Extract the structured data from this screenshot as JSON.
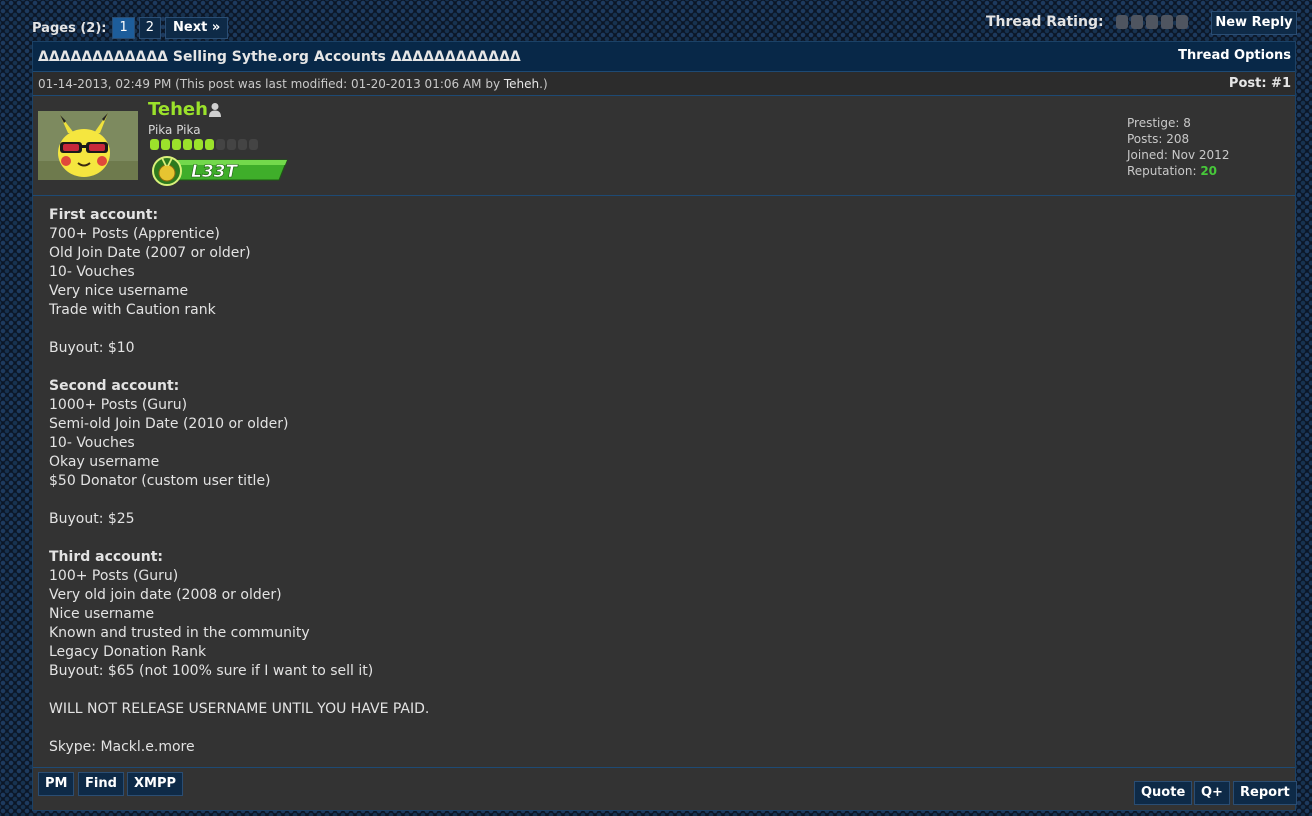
{
  "pagination": {
    "label": "Pages (2):",
    "pages": [
      "1",
      "2"
    ],
    "current": "1",
    "next_label": "Next »"
  },
  "rating": {
    "label": "Thread Rating:",
    "star_count": 5
  },
  "new_reply_label": "New Reply",
  "thread": {
    "title": "ΔΔΔΔΔΔΔΔΔΔΔΔ Selling Sythe.org Accounts ΔΔΔΔΔΔΔΔΔΔΔΔ",
    "options_label": "Thread Options"
  },
  "post": {
    "date_text": "01-14-2013, 02:49 PM (This post was last modified: 01-20-2013 01:06 AM by ",
    "modified_by": "Teheh",
    "date_suffix": ".)",
    "post_number_label": "Post: #1",
    "user": {
      "name": "Teheh",
      "title": "Pika Pika",
      "rank_label": "L33T",
      "pips_on": 6,
      "pips_total": 10,
      "stats": {
        "prestige": "Prestige: 8",
        "posts": "Posts: 208",
        "joined": "Joined: Nov 2012",
        "reputation_label": "Reputation: ",
        "reputation_value": "20"
      }
    },
    "body_lines": [
      {
        "text": "First account:",
        "bold": true
      },
      {
        "text": "700+ Posts (Apprentice)"
      },
      {
        "text": "Old Join Date (2007 or older)"
      },
      {
        "text": "10- Vouches"
      },
      {
        "text": "Very nice username"
      },
      {
        "text": "Trade with Caution rank"
      },
      {
        "text": ""
      },
      {
        "text": "Buyout: $10"
      },
      {
        "text": ""
      },
      {
        "text": "Second account:",
        "bold": true
      },
      {
        "text": "1000+ Posts (Guru)"
      },
      {
        "text": "Semi-old Join Date (2010 or older)"
      },
      {
        "text": "10- Vouches"
      },
      {
        "text": "Okay username"
      },
      {
        "text": "$50 Donator (custom user title)"
      },
      {
        "text": ""
      },
      {
        "text": "Buyout: $25"
      },
      {
        "text": ""
      },
      {
        "text": "Third account:",
        "bold": true
      },
      {
        "text": "100+ Posts (Guru)"
      },
      {
        "text": "Very old join date (2008 or older)"
      },
      {
        "text": "Nice username"
      },
      {
        "text": "Known and trusted in the community"
      },
      {
        "text": "Legacy Donation Rank"
      },
      {
        "text": "Buyout: $65 (not 100% sure if I want to sell it)"
      },
      {
        "text": ""
      },
      {
        "text": "WILL NOT RELEASE USERNAME UNTIL YOU HAVE PAID."
      },
      {
        "text": ""
      },
      {
        "text": "Skype: Mackl.e.more"
      }
    ],
    "footer_left": [
      "PM",
      "Find",
      "XMPP"
    ],
    "footer_right": [
      "Quote",
      "Q+",
      "Report"
    ]
  },
  "colors": {
    "username": "#9be22b",
    "reputation": "#47c83a",
    "header_bg": "#082848",
    "panel_bg": "#333333"
  }
}
